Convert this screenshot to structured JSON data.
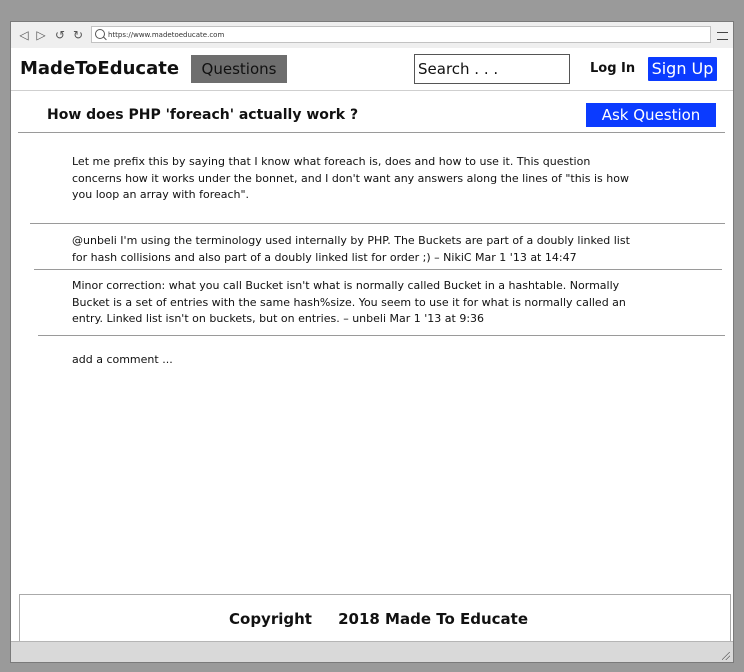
{
  "browser": {
    "url": "https://www.madetoeducate.com"
  },
  "header": {
    "brand": "MadeToEducate",
    "questions_tab": "Questions",
    "search_placeholder": "Search . . .",
    "login": "Log In",
    "signup": "Sign Up"
  },
  "question": {
    "title": "How does PHP 'foreach' actually work ?",
    "ask_button": "Ask Question",
    "body": "Let me prefix this by saying that I know what foreach is, does and how to use it. This question concerns how it works under the bonnet, and I don't want any answers along the lines of \"this is how you loop an array with foreach\"."
  },
  "comments": [
    {
      "text": "@unbeli I'm using the terminology used internally by PHP. The Buckets are part of a doubly linked list for hash collisions and also part of a doubly linked list for order ;) – NikiC Mar 1 '13 at 14:47"
    },
    {
      "text": "Minor correction: what you call Bucket isn't what is normally called Bucket in a hashtable. Normally Bucket is a set of entries with the same hash%size. You seem to use it for what is normally called an entry. Linked list isn't on buckets, but on entries. – unbeli Mar 1 '13 at 9:36"
    }
  ],
  "add_comment": "add a comment ...",
  "footer": {
    "copyright": "Copyright     2018 Made To Educate"
  },
  "colors": {
    "accent": "#0b3bff",
    "tab_active": "#6e6e6e"
  }
}
